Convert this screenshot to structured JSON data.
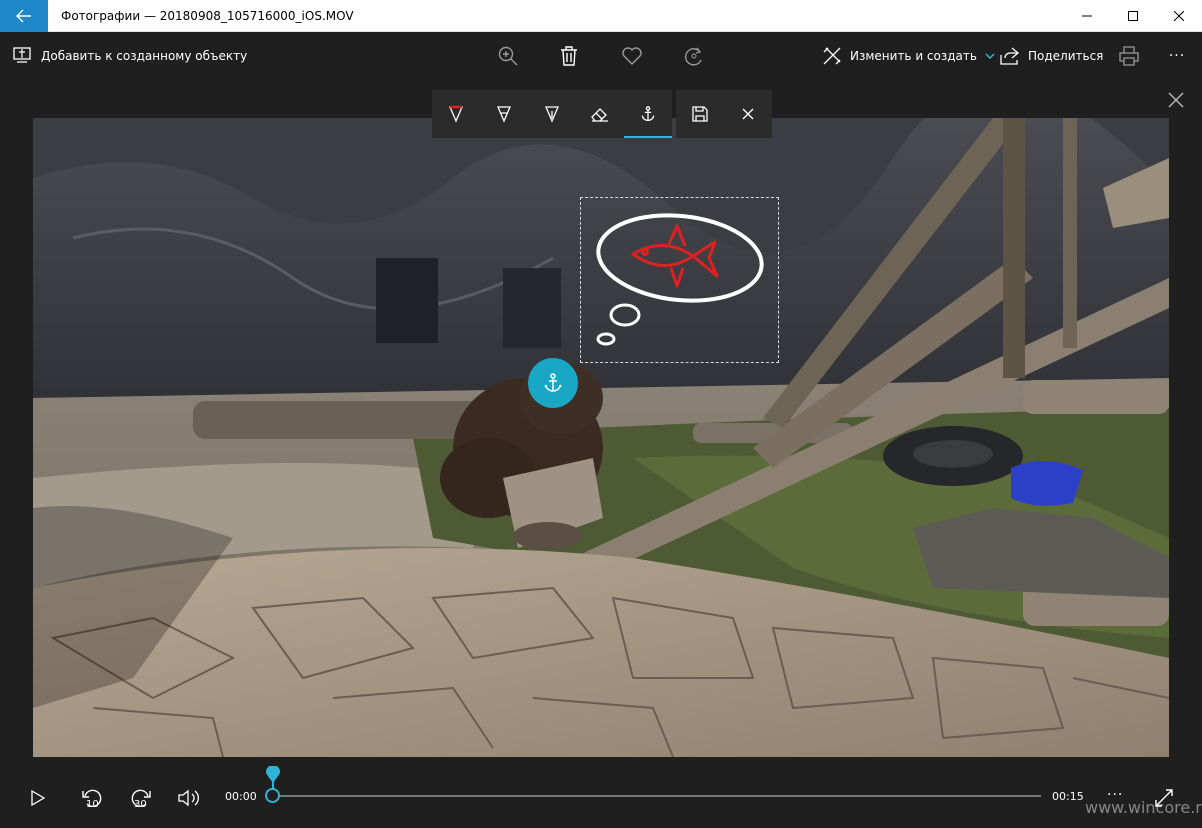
{
  "window": {
    "title": "Фотографии — 20180908_105716000_iOS.MOV",
    "accent": "#1e88c9"
  },
  "commandbar": {
    "add_to_creation": "Добавить к созданному объекту",
    "edit_create": "Изменить и создать",
    "share": "Поделиться",
    "more": "···"
  },
  "ink_toolbar": {
    "tools": [
      "ballpoint-pen",
      "pencil",
      "calligraphy-pen",
      "eraser",
      "anchor"
    ],
    "active_tool": "anchor",
    "accent": "#2fb4d8"
  },
  "playback": {
    "current_time": "00:00",
    "total_time": "00:15",
    "progress": 0,
    "skip_back": "10",
    "skip_forward": "30",
    "more": "···"
  },
  "watermark": "www.wincore.ru"
}
